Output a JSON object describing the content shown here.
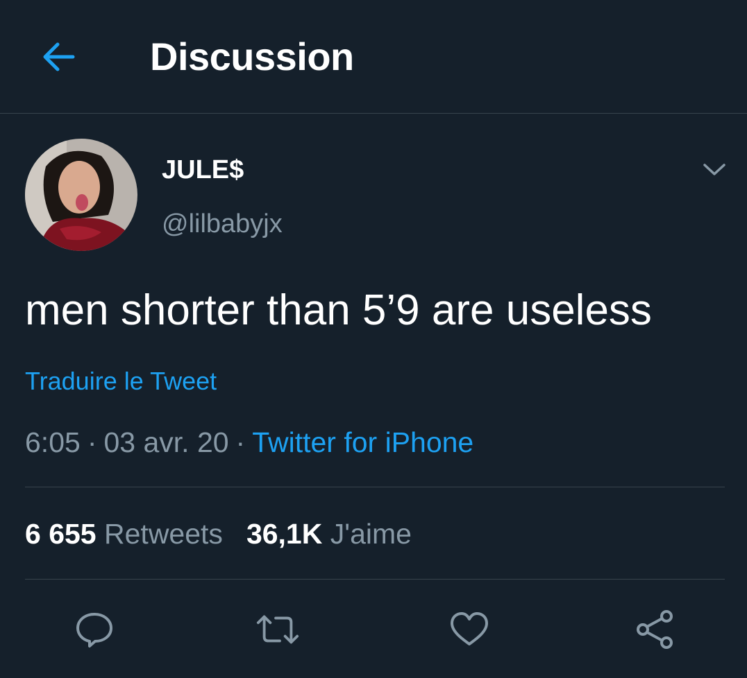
{
  "header": {
    "title": "Discussion",
    "back_icon": "arrow-left-icon"
  },
  "colors": {
    "background": "#15202b",
    "accent": "#1da1f2",
    "secondary_text": "#8899a6",
    "divider": "#38444d"
  },
  "tweet": {
    "author": {
      "display_name": "JULE$",
      "handle": "@lilbabyjx"
    },
    "text": "men shorter than 5’9 are useless",
    "translate_label": "Traduire le Tweet",
    "time": "6:05",
    "date": "03 avr. 20",
    "separator": "·",
    "source": "Twitter for iPhone",
    "stats": {
      "retweets_count": "6 655",
      "retweets_label": "Retweets",
      "likes_count": "36,1K",
      "likes_label": "J'aime"
    },
    "actions": [
      "reply-icon",
      "retweet-icon",
      "like-icon",
      "share-icon"
    ]
  }
}
